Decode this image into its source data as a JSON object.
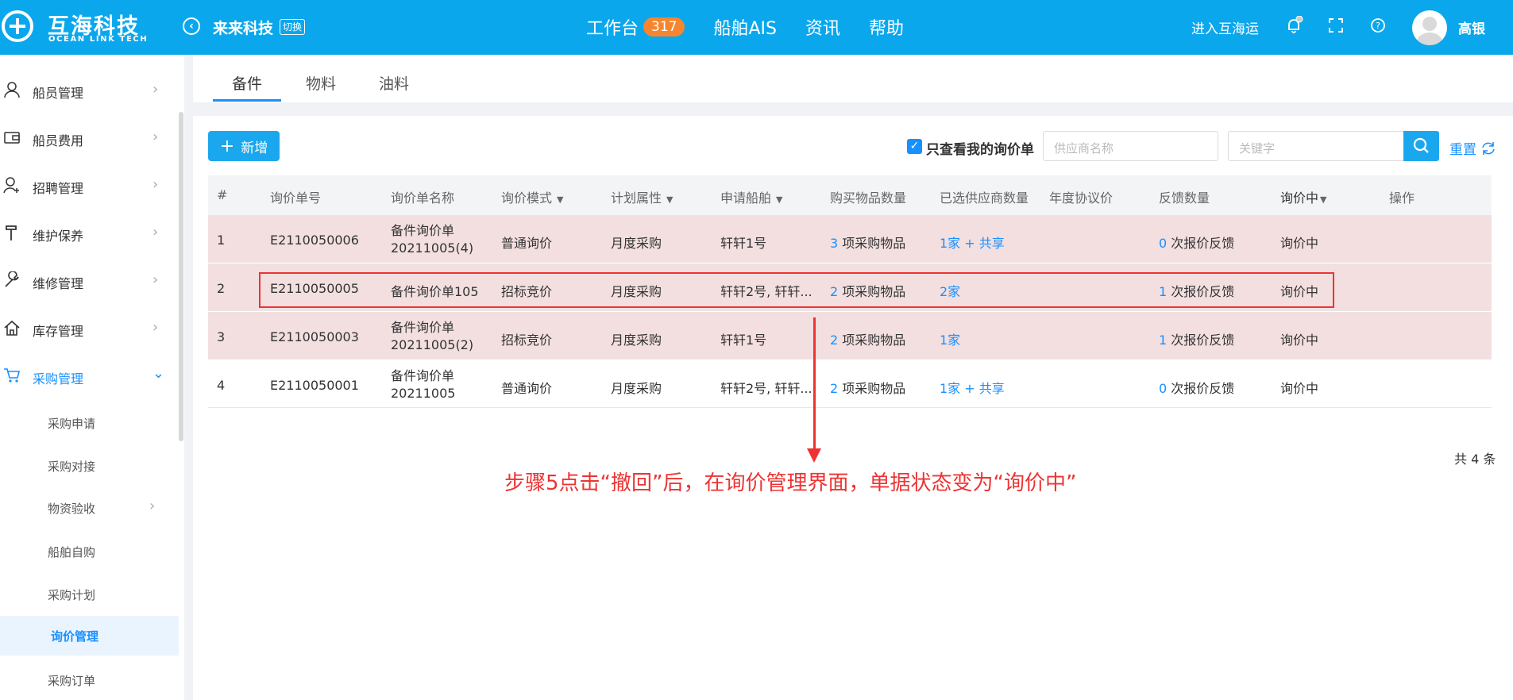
{
  "header": {
    "logo_cn": "互海科技",
    "logo_en": "OCEAN LINK TECH",
    "company": "来来科技",
    "switch_label": "切换",
    "nav": [
      {
        "label": "工作台",
        "badge": "317"
      },
      {
        "label": "船舶AIS"
      },
      {
        "label": "资讯"
      },
      {
        "label": "帮助"
      }
    ],
    "enter_link": "进入互海运",
    "username": "高银"
  },
  "sidebar": {
    "items": [
      {
        "label": "船员管理",
        "icon": "user-icon"
      },
      {
        "label": "船员费用",
        "icon": "wallet-icon"
      },
      {
        "label": "招聘管理",
        "icon": "user-add-icon"
      },
      {
        "label": "维护保养",
        "icon": "hammer-icon"
      },
      {
        "label": "维修管理",
        "icon": "wrench-icon"
      },
      {
        "label": "库存管理",
        "icon": "home-icon"
      },
      {
        "label": "采购管理",
        "icon": "cart-icon"
      }
    ],
    "subitems": [
      {
        "label": "采购申请"
      },
      {
        "label": "采购对接"
      },
      {
        "label": "物资验收"
      },
      {
        "label": "船舶自购"
      },
      {
        "label": "采购计划"
      },
      {
        "label": "询价管理"
      },
      {
        "label": "采购订单"
      }
    ]
  },
  "tabs": [
    "备件",
    "物料",
    "油料"
  ],
  "toolbar": {
    "add_label": "新增",
    "only_mine_label": "只查看我的询价单",
    "supplier_placeholder": "供应商名称",
    "keyword_placeholder": "关键字",
    "reset_label": "重置"
  },
  "table": {
    "headers": [
      "#",
      "询价单号",
      "询价单名称",
      "询价模式",
      "计划属性",
      "申请船舶",
      "购买物品数量",
      "已选供应商数量",
      "年度协议价",
      "反馈数量",
      "询价中",
      "操作"
    ],
    "rows": [
      {
        "no": "1",
        "code": "E2110050006",
        "name": "备件询价单20211005(4)",
        "mode": "普通询价",
        "plan": "月度采购",
        "ship": "轩轩1号",
        "items_num": "3",
        "items_text": " 项采购物品",
        "suppliers": "1家 + 共享",
        "feedback_num": "0",
        "feedback_text": " 次报价反馈",
        "status": "询价中"
      },
      {
        "no": "2",
        "code": "E2110050005",
        "name": "备件询价单105",
        "mode": "招标竞价",
        "plan": "月度采购",
        "ship": "轩轩2号, 轩轩...",
        "items_num": "2",
        "items_text": " 项采购物品",
        "suppliers": "2家",
        "feedback_num": "1",
        "feedback_text": " 次报价反馈",
        "status": "询价中"
      },
      {
        "no": "3",
        "code": "E2110050003",
        "name": "备件询价单20211005(2)",
        "mode": "招标竞价",
        "plan": "月度采购",
        "ship": "轩轩1号",
        "items_num": "2",
        "items_text": " 项采购物品",
        "suppliers": "1家",
        "feedback_num": "1",
        "feedback_text": " 次报价反馈",
        "status": "询价中"
      },
      {
        "no": "4",
        "code": "E2110050001",
        "name": "备件询价单20211005",
        "mode": "普通询价",
        "plan": "月度采购",
        "ship": "轩轩2号, 轩轩...",
        "items_num": "2",
        "items_text": " 项采购物品",
        "suppliers": "1家 + 共享",
        "feedback_num": "0",
        "feedback_text": " 次报价反馈",
        "status": "询价中"
      }
    ],
    "total": "共 4 条"
  },
  "annotation": "步骤5点击“撤回”后，在询价管理界面，单据状态变为“询价中”",
  "colors": {
    "brand": "#0aa7ec",
    "accent": "#1890ff",
    "annotation": "#ee3333",
    "highlight_row": "#f3dfe0"
  }
}
